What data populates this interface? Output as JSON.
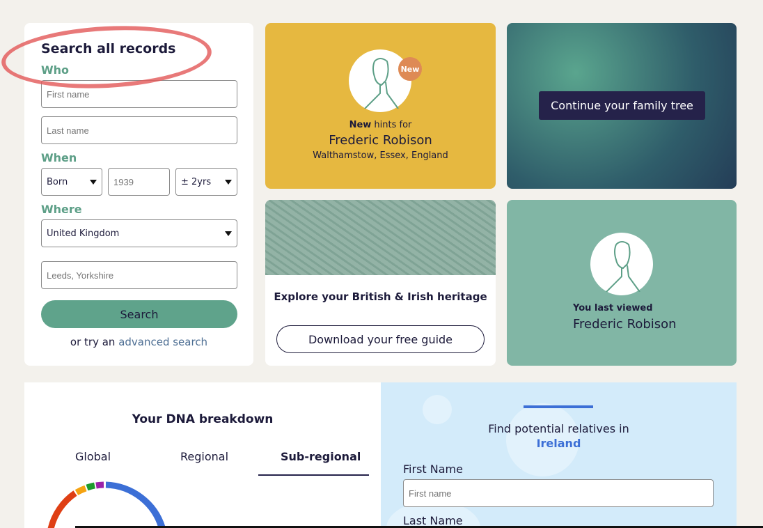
{
  "search": {
    "title": "Search all records",
    "who": "Who",
    "first_name_ph": "First name",
    "last_name_ph": "Last name",
    "when": "When",
    "born": "Born",
    "year_ph": "1939",
    "range": "± 2yrs",
    "where": "Where",
    "country": "United Kingdom",
    "place_ph": "Leeds, Yorkshire",
    "search_btn": "Search",
    "or_try": "or try an ",
    "advanced": "advanced search"
  },
  "hints": {
    "badge": "New",
    "new": "New",
    "hints_for": " hints for",
    "name": "Frederic Robison",
    "place": "Walthamstow, Essex, England"
  },
  "tree": {
    "button": "Continue your family tree"
  },
  "heritage": {
    "title": "Explore your British & Irish heritage",
    "button": "Download your free guide"
  },
  "viewed": {
    "label": "You last viewed",
    "name": "Frederic Robison"
  },
  "dna": {
    "title": "Your DNA breakdown",
    "tabs": [
      "Global",
      "Regional",
      "Sub-regional"
    ],
    "active_tab": "Sub-regional"
  },
  "relatives": {
    "text": "Find potential relatives in",
    "country": "Ireland",
    "first_label": "First Name",
    "first_ph": "First name",
    "last_label": "Last Name"
  },
  "colors": {
    "accent": "#5fa38b",
    "yellow": "#e6b840",
    "navy": "#25224a"
  }
}
